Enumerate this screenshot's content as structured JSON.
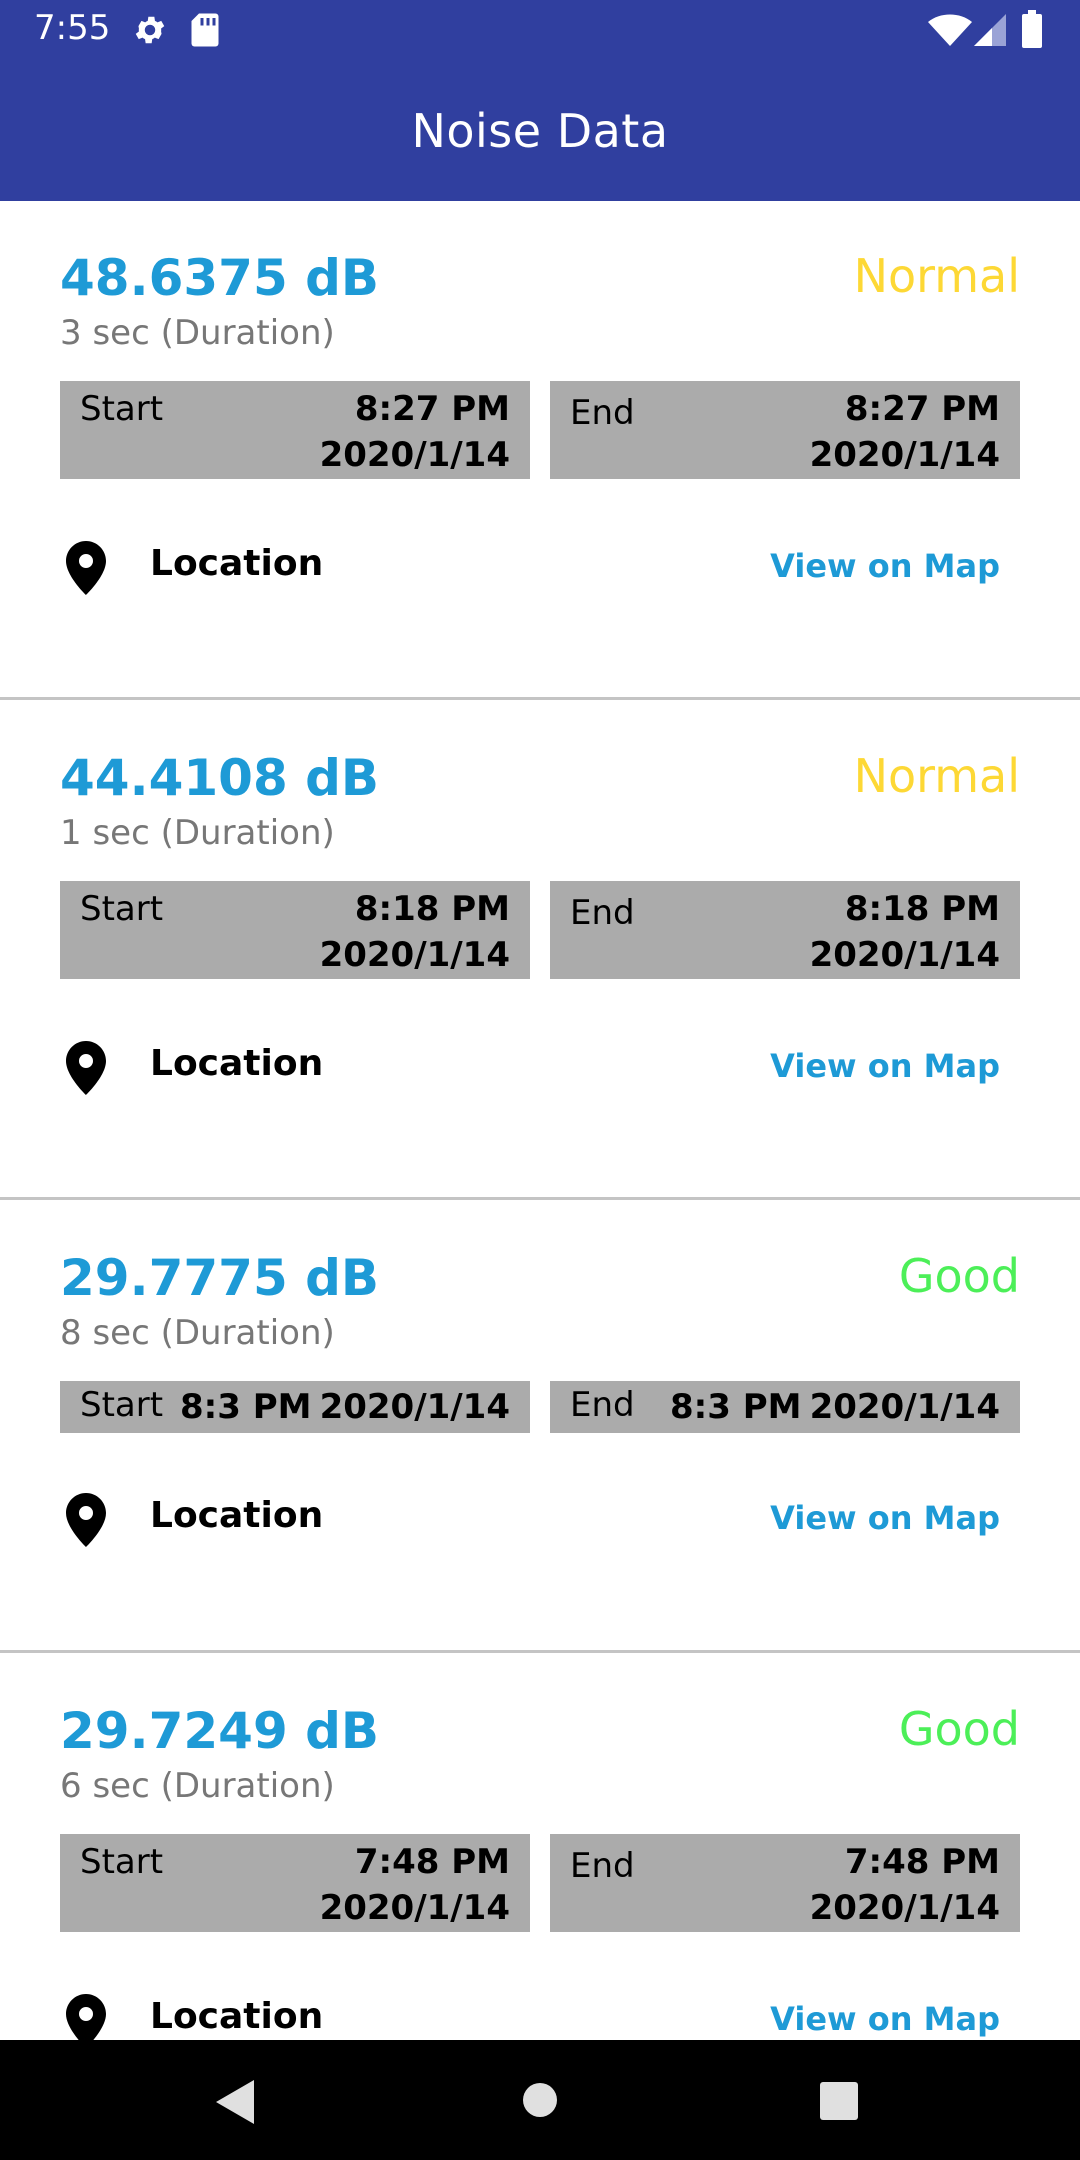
{
  "status_bar": {
    "time": "7:55",
    "icons": [
      "gear-icon",
      "sd-card-icon",
      "wifi-icon",
      "cell-signal-icon",
      "battery-icon"
    ]
  },
  "app_bar": {
    "title": "Noise Data"
  },
  "colors": {
    "primary": "#303f9f",
    "db_value": "#1e9ad6",
    "normal": "#fdd835",
    "good": "#4cef58",
    "time_box": "#ababab"
  },
  "records": [
    {
      "db": "48.6375 dB",
      "status": "Normal",
      "duration": "3 sec (Duration)",
      "start": {
        "label": "Start",
        "time": "8:27 PM",
        "date": "2020/1/14"
      },
      "end": {
        "label": "End",
        "time": "8:27 PM",
        "date": "2020/1/14"
      },
      "location_label": "Location",
      "map_link": "View on Map"
    },
    {
      "db": "44.4108 dB",
      "status": "Normal",
      "duration": "1 sec (Duration)",
      "start": {
        "label": "Start",
        "time": "8:18 PM",
        "date": "2020/1/14"
      },
      "end": {
        "label": "End",
        "time": "8:18 PM",
        "date": "2020/1/14"
      },
      "location_label": "Location",
      "map_link": "View on Map"
    },
    {
      "db": "29.7775 dB",
      "status": "Good",
      "duration": "8 sec (Duration)",
      "start": {
        "label": "Start",
        "time": "8:3 PM",
        "date": "2020/1/14"
      },
      "end": {
        "label": "End",
        "time": "8:3 PM",
        "date": "2020/1/14"
      },
      "location_label": "Location",
      "map_link": "View on Map"
    },
    {
      "db": "29.7249 dB",
      "status": "Good",
      "duration": "6 sec (Duration)",
      "start": {
        "label": "Start",
        "time": "7:48 PM",
        "date": "2020/1/14"
      },
      "end": {
        "label": "End",
        "time": "7:48 PM",
        "date": "2020/1/14"
      },
      "location_label": "Location",
      "map_link": "View on Map"
    }
  ],
  "nav_bar": {
    "buttons": [
      "back-icon",
      "home-icon",
      "recents-icon"
    ]
  }
}
